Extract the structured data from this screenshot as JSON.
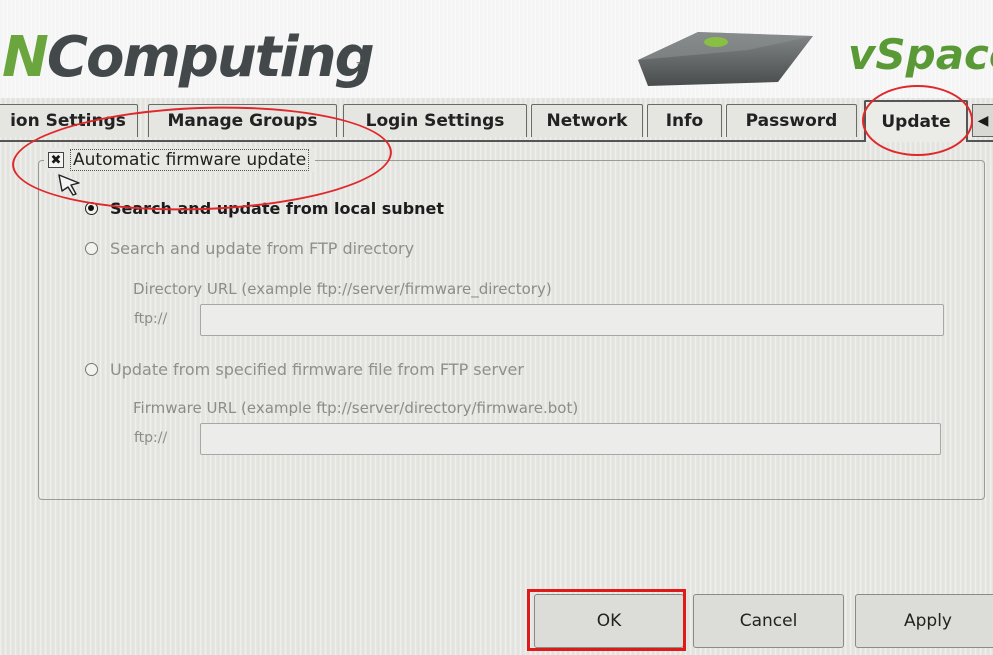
{
  "header": {
    "logo_text_first": "N",
    "logo_text_rest": "Computing",
    "logo_tm": "™",
    "vspace_logo": "vSpace",
    "vspace_tm": "™"
  },
  "tabs": [
    {
      "label": "ion Settings",
      "active": false
    },
    {
      "label": "Manage Groups",
      "active": false
    },
    {
      "label": "Login Settings",
      "active": false
    },
    {
      "label": "Network",
      "active": false
    },
    {
      "label": "Info",
      "active": false
    },
    {
      "label": "Password",
      "active": false
    },
    {
      "label": "Update",
      "active": true
    }
  ],
  "tab_scroll": {
    "icon": "triangle-left-icon",
    "glyph": "◀"
  },
  "update_panel": {
    "auto_update_label": "Automatic firmware update",
    "auto_update_checked": true,
    "check_glyph": "✖",
    "options": [
      {
        "label": "Search and update from local subnet",
        "selected": true
      },
      {
        "label": "Search and update from FTP directory",
        "selected": false
      },
      {
        "label": "Update from specified firmware file from FTP server",
        "selected": false
      }
    ],
    "directory_hint": "Directory URL (example ftp://server/firmware_directory)",
    "directory_prefix": "ftp://",
    "directory_value": "",
    "firmware_hint": "Firmware URL (example ftp://server/directory/firmware.bot)",
    "firmware_prefix": "ftp://",
    "firmware_value": ""
  },
  "buttons": {
    "ok": "OK",
    "cancel": "Cancel",
    "apply": "Apply"
  },
  "colors": {
    "annotation_red": "#e0282a",
    "brand_green": "#6aa53d"
  }
}
